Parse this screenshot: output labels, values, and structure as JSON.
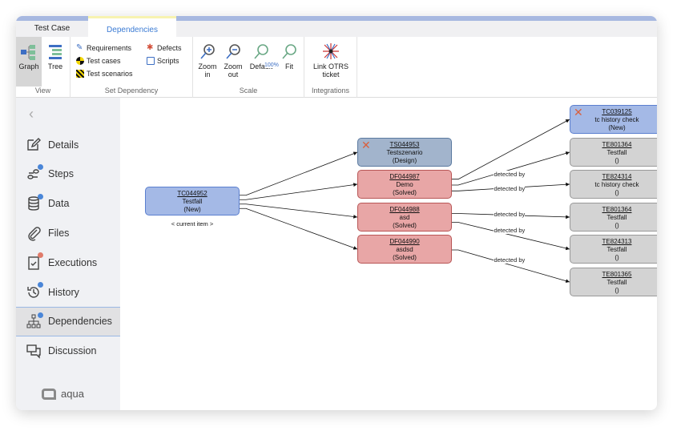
{
  "tabs": [
    {
      "label": "Test Case"
    },
    {
      "label": "Dependencies",
      "active": true
    }
  ],
  "ribbon": {
    "view": {
      "label": "View",
      "graph": "Graph",
      "tree": "Tree"
    },
    "set_dependency": {
      "label": "Set Dependency",
      "items": [
        "Requirements",
        "Test cases",
        "Test scenarios",
        "Defects",
        "Scripts"
      ]
    },
    "scale": {
      "label": "Scale",
      "zoom_in": [
        "Zoom",
        "in"
      ],
      "zoom_out": [
        "Zoom",
        "out"
      ],
      "default": "Default",
      "default_badge": "100%",
      "fit": "Fit"
    },
    "integrations": {
      "label": "Integrations",
      "link": [
        "Link OTRS",
        "ticket"
      ]
    }
  },
  "sidebar": {
    "items": [
      {
        "label": "Details",
        "icon": "edit-icon",
        "dot": null
      },
      {
        "label": "Steps",
        "icon": "steps-icon",
        "dot": "#4a86d8"
      },
      {
        "label": "Data",
        "icon": "database-icon",
        "dot": "#4a86d8"
      },
      {
        "label": "Files",
        "icon": "paperclip-icon",
        "dot": null
      },
      {
        "label": "Executions",
        "icon": "clipboard-check-icon",
        "dot": "#e07b6a"
      },
      {
        "label": "History",
        "icon": "history-icon",
        "dot": "#4a86d8"
      },
      {
        "label": "Dependencies",
        "icon": "sitemap-icon",
        "dot": "#4a86d8",
        "active": true
      },
      {
        "label": "Discussion",
        "icon": "chat-icon",
        "dot": null
      }
    ],
    "logo": "aqua"
  },
  "graph": {
    "current_label": "< current item >",
    "edge_label": "detected by",
    "colors": {
      "testcase": "#a4b9e6",
      "scenario": "#a2b4cc",
      "defect": "#e8a6a6",
      "execution": "#d3d3d3"
    },
    "nodes": [
      {
        "id": "TC044952",
        "name": "Testfall",
        "status": "(New)",
        "type": "testcase"
      },
      {
        "id": "TS044953",
        "name": "Testszenario",
        "status": "(Design)",
        "type": "scenario",
        "removable": true
      },
      {
        "id": "DF044987",
        "name": "Demo",
        "status": "(Solved)",
        "type": "defect"
      },
      {
        "id": "DF044988",
        "name": "asd",
        "status": "(Solved)",
        "type": "defect"
      },
      {
        "id": "DF044990",
        "name": "asdsd",
        "status": "(Solved)",
        "type": "defect"
      },
      {
        "id": "TC039125",
        "name": "tc history check",
        "status": "(New)",
        "type": "testcase",
        "removable": true
      },
      {
        "id": "TE801364",
        "name": "Testfall",
        "status": "()",
        "type": "execution"
      },
      {
        "id": "TE824314",
        "name": "tc history check",
        "status": "()",
        "type": "execution"
      },
      {
        "id": "TE801364",
        "name": "Testfall",
        "status": "()",
        "type": "execution"
      },
      {
        "id": "TE824313",
        "name": "Testfall",
        "status": "()",
        "type": "execution"
      },
      {
        "id": "TE801365",
        "name": "Testfall",
        "status": "()",
        "type": "execution"
      }
    ],
    "edges": [
      [
        0,
        1,
        false
      ],
      [
        0,
        2,
        false
      ],
      [
        0,
        3,
        false
      ],
      [
        0,
        4,
        false
      ],
      [
        2,
        5,
        false
      ],
      [
        2,
        6,
        true
      ],
      [
        2,
        7,
        true
      ],
      [
        3,
        8,
        true
      ],
      [
        3,
        9,
        true
      ],
      [
        4,
        10,
        true
      ]
    ]
  }
}
